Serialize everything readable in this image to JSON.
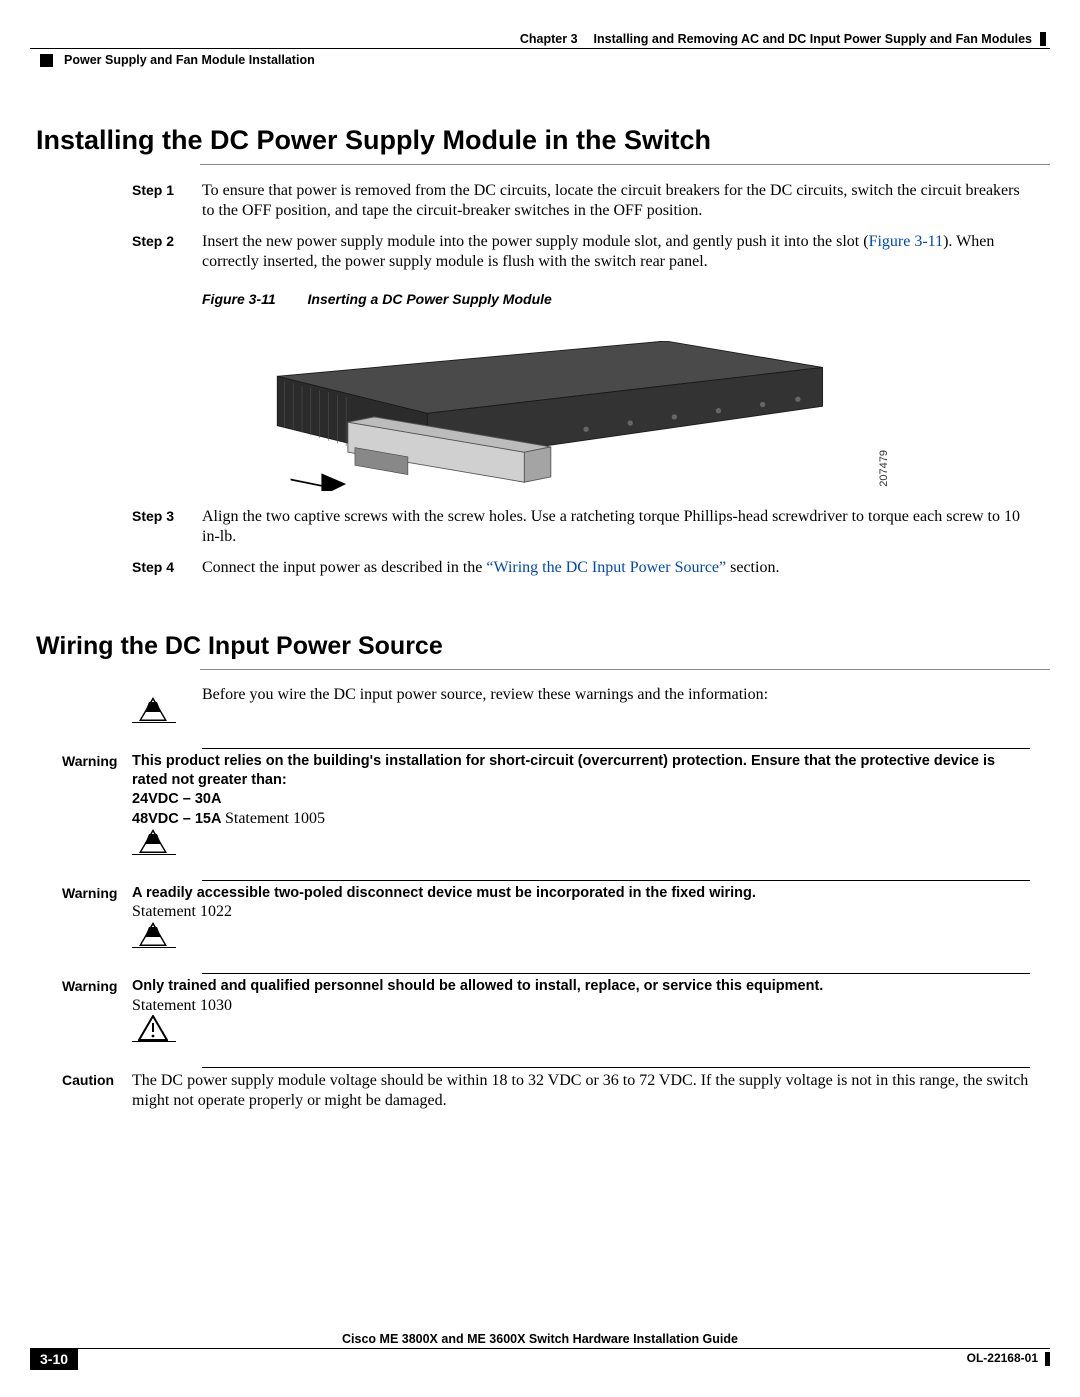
{
  "header": {
    "chapter_label": "Chapter 3",
    "chapter_title": "Installing and Removing AC and DC Input Power Supply and Fan Modules",
    "section_path": "Power Supply and Fan Module Installation"
  },
  "section1": {
    "title": "Installing the DC Power Supply Module in the Switch",
    "steps": [
      {
        "label": "Step 1",
        "text": "To ensure that power is removed from the DC circuits, locate the circuit breakers for the DC circuits, switch the circuit breakers to the OFF position, and tape the circuit-breaker switches in the OFF position."
      },
      {
        "label": "Step 2",
        "text_pre": "Insert the new power supply module into the power supply module slot, and gently push it into the slot (",
        "xref": "Figure 3-11",
        "text_post": "). When correctly inserted, the power supply module is flush with the switch rear panel."
      },
      {
        "label": "Step 3",
        "text": "Align the two captive screws with the screw holes. Use a ratcheting torque Phillips-head screwdriver to torque each screw to 10 in-lb."
      },
      {
        "label": "Step 4",
        "text_pre": "Connect the input power as described in the ",
        "quoted_link": "“Wiring the DC Input Power Source”",
        "text_post": " section."
      }
    ],
    "figure": {
      "num": "Figure 3-11",
      "caption": "Inserting a DC Power Supply Module",
      "image_num": "207479"
    }
  },
  "section2": {
    "title": "Wiring the DC Input Power Source",
    "intro": "Before you wire the DC input power source, review these warnings and the information:",
    "notices": [
      {
        "type": "Warning",
        "body_bold": "This product relies on the building's installation for short-circuit (overcurrent) protection. Ensure that the protective device is rated not greater than:",
        "lines": [
          "24VDC – 30A",
          "48VDC – 15A"
        ],
        "stmt": "Statement 1005"
      },
      {
        "type": "Warning",
        "body_bold": "A readily accessible two-poled disconnect device must be incorporated in the fixed wiring.",
        "stmt": "Statement 1022"
      },
      {
        "type": "Warning",
        "body_bold": "Only trained and qualified personnel should be allowed to install, replace, or service this equipment.",
        "stmt": "Statement 1030"
      },
      {
        "type": "Caution",
        "body_plain": "The DC power supply module voltage should be within 18 to 32 VDC or 36 to 72 VDC. If the supply voltage is not in this range, the switch might not operate properly or might be damaged."
      }
    ]
  },
  "footer": {
    "book_title": "Cisco ME 3800X and ME 3600X Switch Hardware Installation Guide",
    "page_num": "3-10",
    "doc_id": "OL-22168-01"
  }
}
